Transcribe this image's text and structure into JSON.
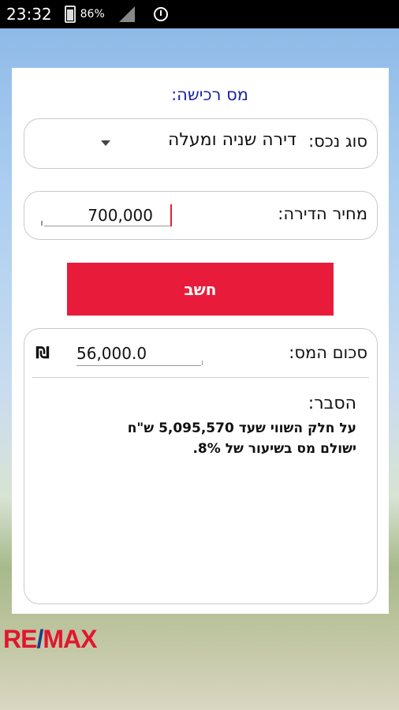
{
  "status_bar": {
    "time": "23:32",
    "battery": "86%"
  },
  "form": {
    "title": "מס רכישה:",
    "property_type_label": "סוג נכס:",
    "property_type_value": "דירה שניה ומעלה",
    "price_label": "מחיר הדירה:",
    "price_value": "700,000",
    "calculate_label": "חשב"
  },
  "result": {
    "tax_label": "סכום המס:",
    "tax_value": "56,000.0",
    "currency": "₪",
    "explanation_title": "הסבר:",
    "explanation_line1": "על חלק השווי שעד 5,095,570 ש\"ח",
    "explanation_line2": "ישולם מס בשיעור של 8%."
  },
  "brand": {
    "logo_left": "RE",
    "logo_slash": "/",
    "logo_right": "MAX"
  }
}
